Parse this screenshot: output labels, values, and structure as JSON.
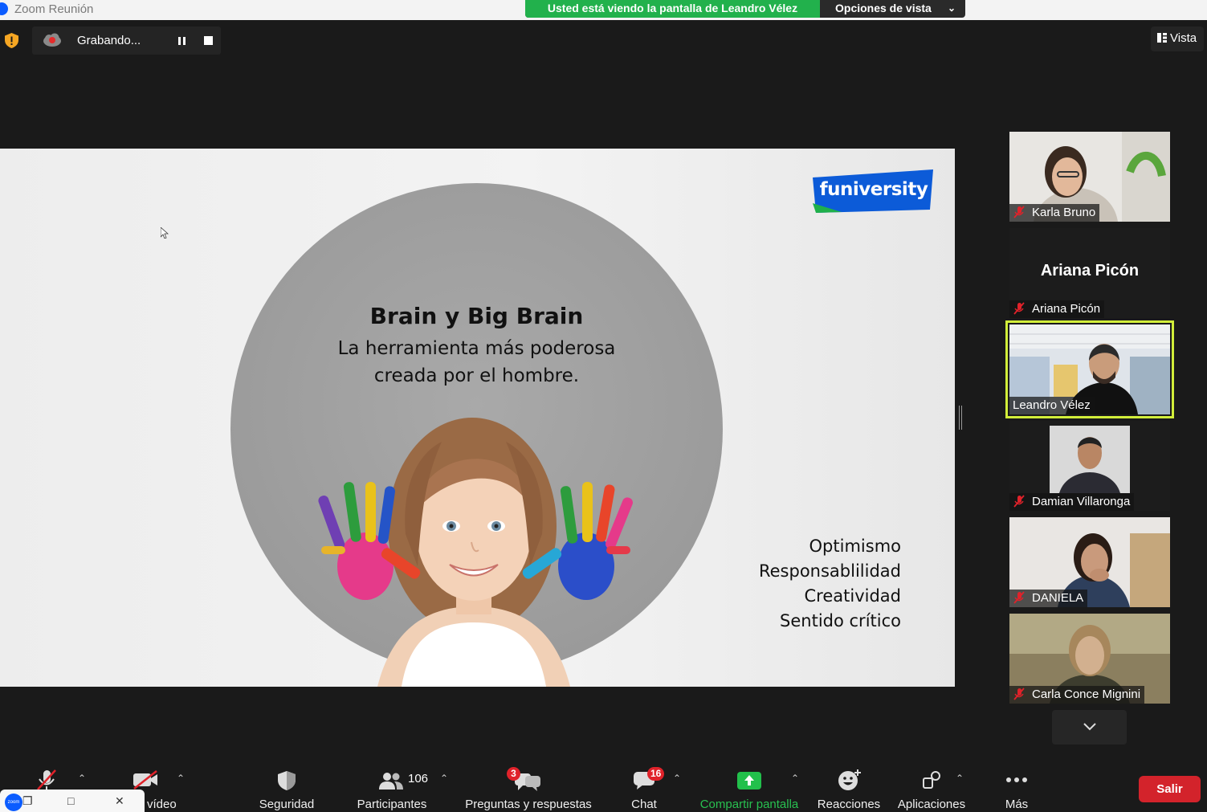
{
  "window": {
    "title": "Zoom Reunión"
  },
  "share_banner": {
    "viewing_text": "Usted está viendo la pantalla de Leandro Vélez",
    "view_options_label": "Opciones de vista"
  },
  "recording": {
    "label": "Grabando..."
  },
  "view_button": {
    "label": "Vista"
  },
  "slide": {
    "logo_text": "funiversity",
    "title": "Brain y Big Brain",
    "subtitle_line1": "La herramienta más poderosa",
    "subtitle_line2": "creada por el hombre.",
    "values": [
      "Optimismo",
      "Responsablilidad",
      "Creatividad",
      "Sentido crítico"
    ]
  },
  "participants": [
    {
      "name": "Karla Bruno",
      "muted": true,
      "video": true
    },
    {
      "name": "Ariana Picón",
      "display_name": "Ariana Picón",
      "muted": true,
      "video": false
    },
    {
      "name": "Leandro Vélez",
      "muted": false,
      "video": true,
      "active_speaker": true
    },
    {
      "name": "Damian Villaronga",
      "muted": true,
      "video": true
    },
    {
      "name": "DANIELA",
      "muted": true,
      "video": true
    },
    {
      "name": "Carla Conce Mignini",
      "muted": true,
      "video": true
    }
  ],
  "toolbar": {
    "video_label": "vídeo",
    "security_label": "Seguridad",
    "participants_label": "Participantes",
    "participants_count": "106",
    "qa_label": "Preguntas y respuestas",
    "qa_badge": "3",
    "chat_label": "Chat",
    "chat_badge": "16",
    "share_label": "Compartir pantalla",
    "reactions_label": "Reacciones",
    "apps_label": "Aplicaciones",
    "more_label": "Más",
    "leave_label": "Salir"
  },
  "taskbar_thumb": {
    "app_label": "zoom"
  },
  "colors": {
    "share_green": "#22b14c",
    "leave_red": "#d3232b",
    "active_border": "#d2ee3a",
    "badge_red": "#e0222a"
  }
}
